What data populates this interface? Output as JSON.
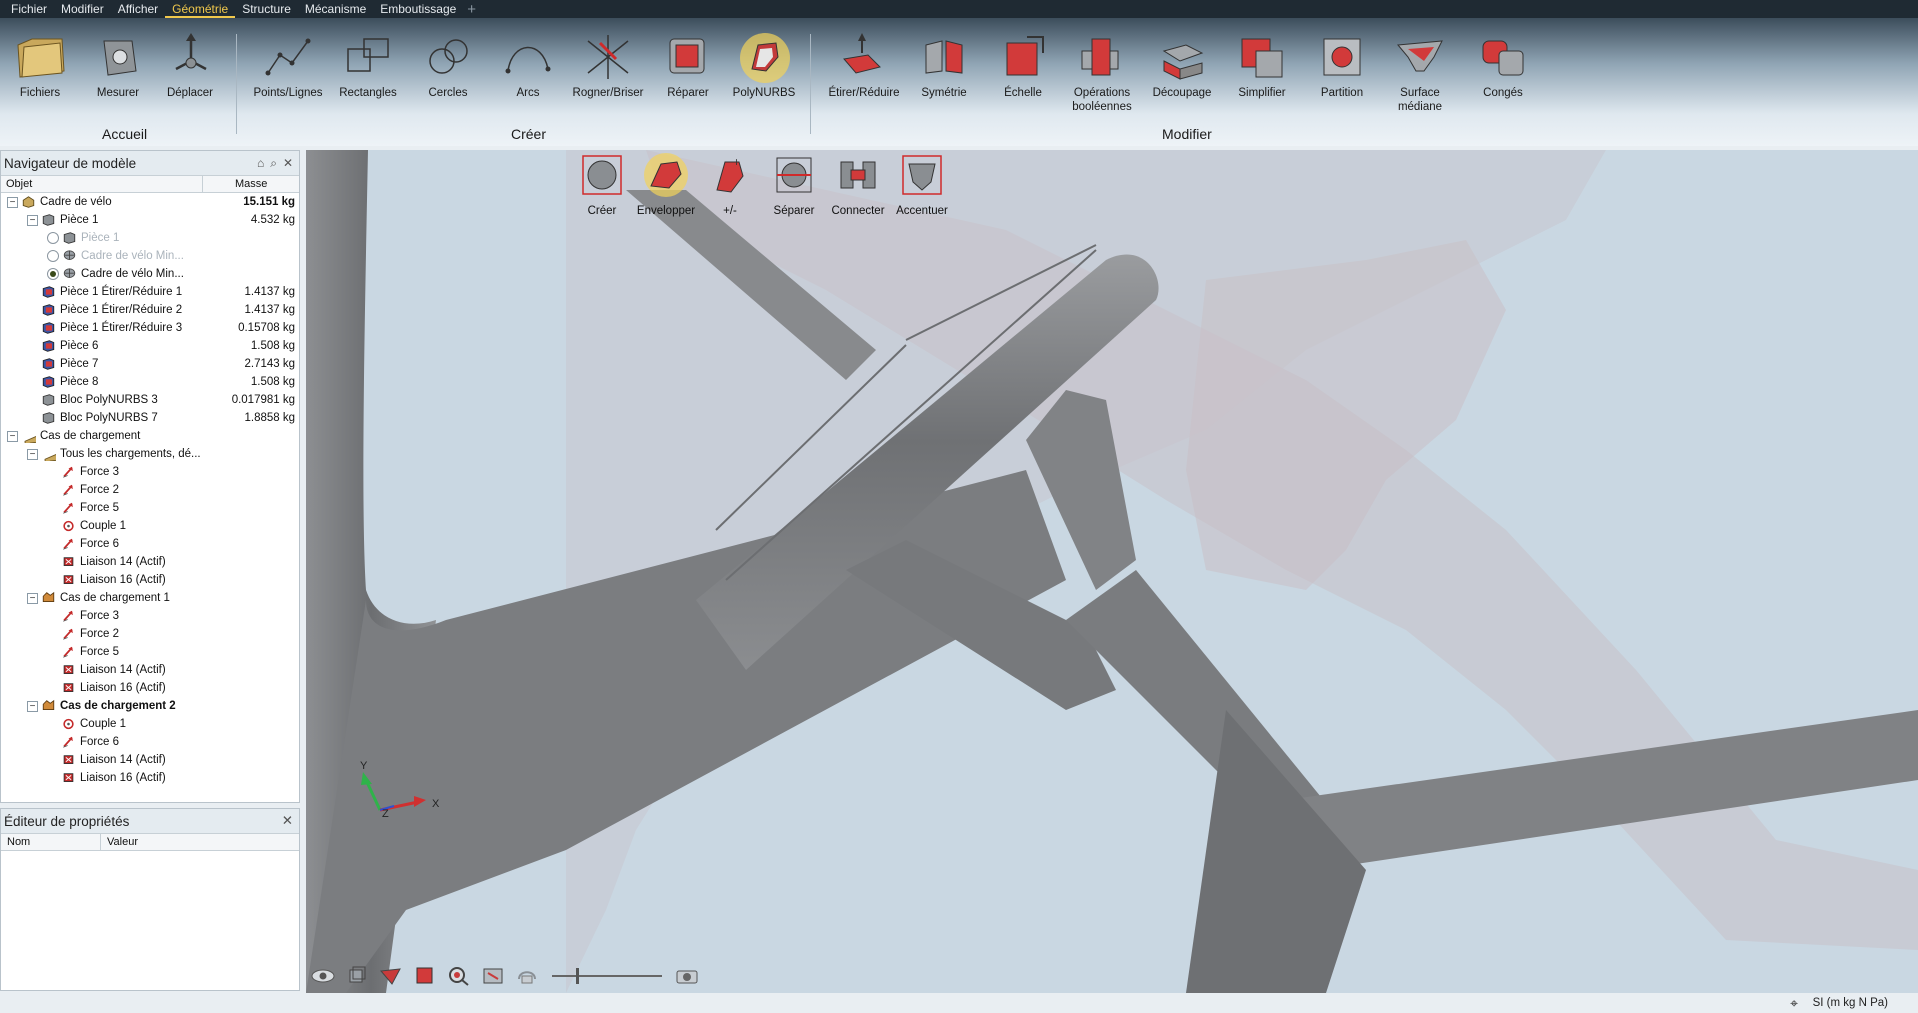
{
  "menu": {
    "items": [
      "Fichier",
      "Modifier",
      "Afficher",
      "Géométrie",
      "Structure",
      "Mécanisme",
      "Emboutissage"
    ],
    "active_index": 3
  },
  "ribbon": {
    "groups": [
      "Accueil",
      "Créer",
      "Modifier"
    ],
    "accueil": [
      {
        "label": "Fichiers",
        "icon": "folder-icon"
      },
      {
        "label": "Mesurer",
        "icon": "measure-icon"
      },
      {
        "label": "Déplacer",
        "icon": "move-icon"
      }
    ],
    "creer": [
      {
        "label": "Points/Lignes",
        "icon": "points-lines-icon"
      },
      {
        "label": "Rectangles",
        "icon": "rectangles-icon"
      },
      {
        "label": "Cercles",
        "icon": "circles-icon"
      },
      {
        "label": "Arcs",
        "icon": "arcs-icon"
      },
      {
        "label": "Rogner/Briser",
        "icon": "trim-icon"
      },
      {
        "label": "Réparer",
        "icon": "repair-icon"
      },
      {
        "label": "PolyNURBS",
        "icon": "polynurbs-icon"
      }
    ],
    "modifier": [
      {
        "label": "Étirer/Réduire",
        "icon": "push-pull-icon"
      },
      {
        "label": "Symétrie",
        "icon": "mirror-icon"
      },
      {
        "label": "Échelle",
        "icon": "scale-icon"
      },
      {
        "label": "Opérations booléennes",
        "icon": "boolean-icon"
      },
      {
        "label": "Découpage",
        "icon": "split-icon"
      },
      {
        "label": "Simplifier",
        "icon": "simplify-icon"
      },
      {
        "label": "Partition",
        "icon": "partition-icon"
      },
      {
        "label": "Surface médiane",
        "icon": "midsurface-icon"
      },
      {
        "label": "Congés",
        "icon": "fillets-icon"
      }
    ]
  },
  "navigator": {
    "title": "Navigateur de modèle",
    "col_object": "Objet",
    "col_mass": "Masse",
    "rows": [
      {
        "level": 0,
        "exp": "−",
        "icon": "assembly-icon",
        "label": "Cadre de vélo",
        "mass": "15.151 kg",
        "mass_bold": true
      },
      {
        "level": 1,
        "exp": "−",
        "icon": "part-icon",
        "label": "Pièce 1",
        "mass": "4.532 kg"
      },
      {
        "level": 2,
        "radio": "off",
        "icon": "part-icon",
        "label": "Pièce 1",
        "dim": true
      },
      {
        "level": 2,
        "radio": "off",
        "icon": "mesh-icon",
        "label": "Cadre de vélo Min...",
        "dim": true
      },
      {
        "level": 2,
        "radio": "on",
        "icon": "mesh-icon",
        "label": "Cadre de vélo Min..."
      },
      {
        "level": 1,
        "icon": "red-part-icon",
        "label": "Pièce 1 Étirer/Réduire 1",
        "mass": "1.4137 kg"
      },
      {
        "level": 1,
        "icon": "red-part-icon",
        "label": "Pièce 1 Étirer/Réduire 2",
        "mass": "1.4137 kg"
      },
      {
        "level": 1,
        "icon": "red-part-icon",
        "label": "Pièce 1 Étirer/Réduire 3",
        "mass": "0.15708 kg"
      },
      {
        "level": 1,
        "icon": "red-part-icon",
        "label": "Pièce 6",
        "mass": "1.508 kg"
      },
      {
        "level": 1,
        "icon": "red-part-icon",
        "label": "Pièce 7",
        "mass": "2.7143 kg"
      },
      {
        "level": 1,
        "icon": "red-part-icon",
        "label": "Pièce 8",
        "mass": "1.508 kg"
      },
      {
        "level": 1,
        "icon": "part-icon",
        "label": "Bloc PolyNURBS 3",
        "mass": "0.017981 kg"
      },
      {
        "level": 1,
        "icon": "part-icon",
        "label": "Bloc PolyNURBS 7",
        "mass": "1.8858 kg"
      },
      {
        "level": 0,
        "exp": "−",
        "icon": "folder-icon",
        "label": "Cas de chargement"
      },
      {
        "level": 1,
        "exp": "−",
        "icon": "folder-icon",
        "label": "Tous les chargements, dé..."
      },
      {
        "level": 2,
        "icon": "force-icon",
        "label": "Force 3"
      },
      {
        "level": 2,
        "icon": "force-icon",
        "label": "Force 2"
      },
      {
        "level": 2,
        "icon": "force-icon",
        "label": "Force 5"
      },
      {
        "level": 2,
        "icon": "torque-icon",
        "label": "Couple 1"
      },
      {
        "level": 2,
        "icon": "force-icon",
        "label": "Force 6"
      },
      {
        "level": 2,
        "icon": "support-icon",
        "label": "Liaison 14 (Actif)"
      },
      {
        "level": 2,
        "icon": "support-icon",
        "label": "Liaison 16 (Actif)"
      },
      {
        "level": 1,
        "exp": "−",
        "icon": "loadcase-icon",
        "label": "Cas de chargement 1"
      },
      {
        "level": 2,
        "icon": "force-icon",
        "label": "Force 3"
      },
      {
        "level": 2,
        "icon": "force-icon",
        "label": "Force 2"
      },
      {
        "level": 2,
        "icon": "force-icon",
        "label": "Force 5"
      },
      {
        "level": 2,
        "icon": "support-icon",
        "label": "Liaison 14 (Actif)"
      },
      {
        "level": 2,
        "icon": "support-icon",
        "label": "Liaison 16 (Actif)"
      },
      {
        "level": 1,
        "exp": "−",
        "icon": "loadcase-icon",
        "label": "Cas de chargement 2",
        "bold": true
      },
      {
        "level": 2,
        "icon": "torque-icon",
        "label": "Couple 1"
      },
      {
        "level": 2,
        "icon": "force-icon",
        "label": "Force 6"
      },
      {
        "level": 2,
        "icon": "support-icon",
        "label": "Liaison 14 (Actif)"
      },
      {
        "level": 2,
        "icon": "support-icon",
        "label": "Liaison 16 (Actif)"
      }
    ]
  },
  "properties": {
    "title": "Éditeur de propriétés",
    "col_name": "Nom",
    "col_value": "Valeur"
  },
  "polynurbs_toolbar": [
    {
      "label": "Créer",
      "icon": "create-sphere-icon"
    },
    {
      "label": "Envelopper",
      "icon": "wrap-icon"
    },
    {
      "label": "+/-",
      "icon": "plus-minus-icon"
    },
    {
      "label": "Séparer",
      "icon": "separate-icon"
    },
    {
      "label": "Connecter",
      "icon": "connect-icon"
    },
    {
      "label": "Accentuer",
      "icon": "sharpen-icon"
    }
  ],
  "triad": {
    "y": "Y",
    "z": "Z",
    "x": "X"
  },
  "status": {
    "units": "SI (m kg N Pa)"
  },
  "colors": {
    "accent": "#f0c84c",
    "viewport_bg": "#c9d7e2",
    "tube": "#7d7f82",
    "mesh": "#c7b5bb"
  }
}
